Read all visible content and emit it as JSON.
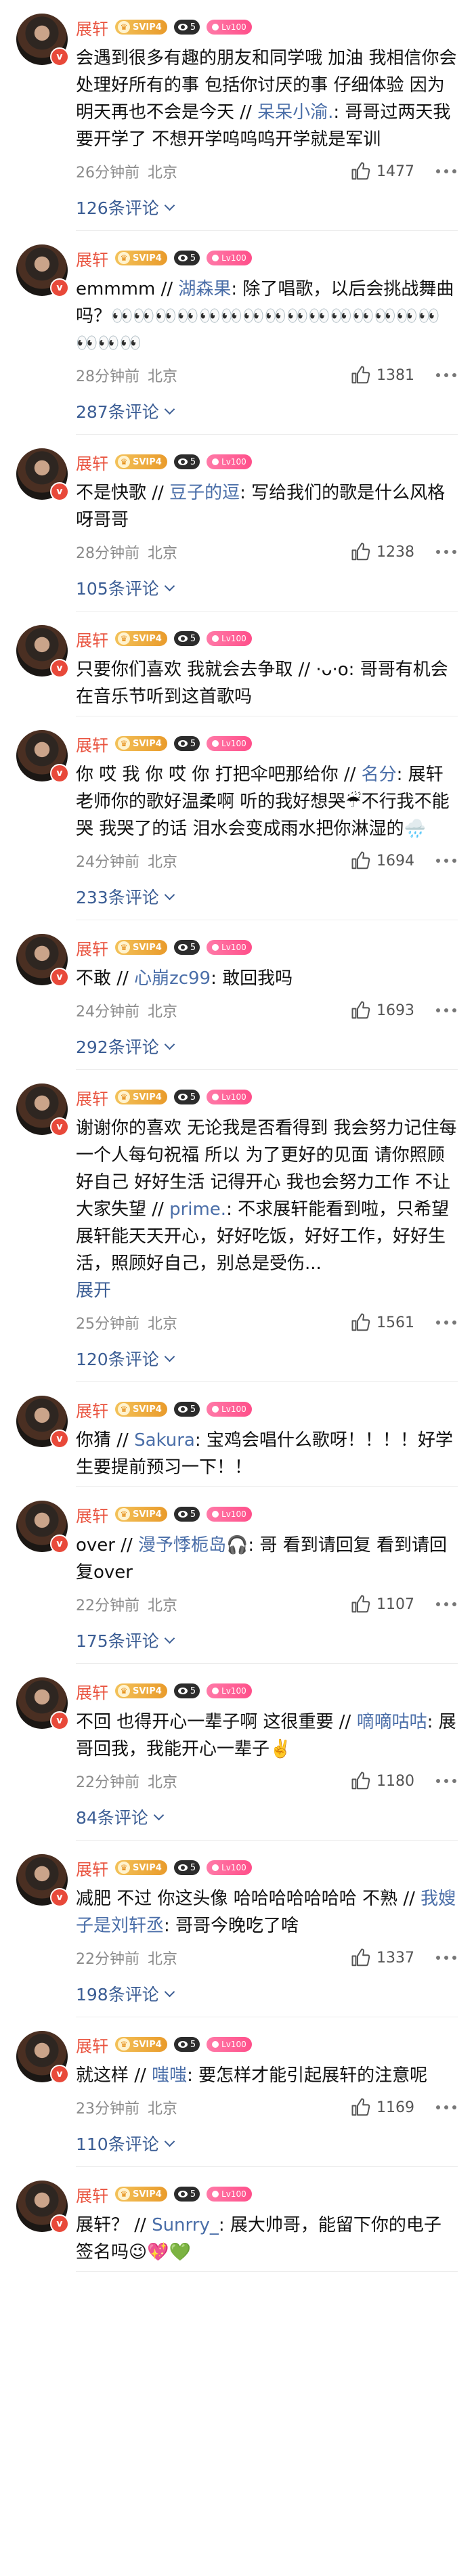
{
  "user": {
    "name": "展轩",
    "svip_label": "SVIP4",
    "weibo_badge": "5",
    "level_label": "Lv100",
    "verified_mark": "v"
  },
  "colors": {
    "name": "#e9533f",
    "mention": "#4a6ea8",
    "link": "#3b5d94"
  },
  "icons": {
    "like": "thumbs-up-icon",
    "more": "more-dots-icon",
    "expand": "chevron-down-icon"
  },
  "comments": [
    {
      "lead": "会遇到很多有趣的朋友和同学哦 加油 我相信你会处理好所有的事 包括你讨厌的事 仔细体验 因为明天再也不会是今天 // ",
      "mention": "呆呆小渝.",
      "tail": ": 哥哥过两天我要开学了 不想开学呜呜呜开学就是军训",
      "time": "26分钟前",
      "location": "北京",
      "likes": "1477",
      "replies": "126条评论",
      "expand": ""
    },
    {
      "lead": "emmmm // ",
      "mention": "湖森果",
      "tail": ": 除了唱歌，以后会挑战舞曲吗？👀👀👀👀👀👀👀👀👀👀👀👀👀👀👀👀👀👀",
      "time": "28分钟前",
      "location": "北京",
      "likes": "1381",
      "replies": "287条评论",
      "expand": ""
    },
    {
      "lead": "不是快歌 // ",
      "mention": "豆子的逗",
      "tail": ": 写给我们的歌是什么风格呀哥哥",
      "time": "28分钟前",
      "location": "北京",
      "likes": "1238",
      "replies": "105条评论",
      "expand": ""
    },
    {
      "lead": "只要你们喜欢 我就会去争取 // ",
      "mention": "",
      "tail": "·ᴗ·ο: 哥哥有机会在音乐节听到这首歌吗",
      "time": "",
      "location": "",
      "likes": "",
      "replies": "",
      "expand": ""
    },
    {
      "lead": "你 哎 我 你 哎 你 打把伞吧那给你 // ",
      "mention": "名分",
      "tail": ": 展轩老师你的歌好温柔啊 听的我好想哭☔不行我不能哭 我哭了的话 泪水会变成雨水把你淋湿的🌧️",
      "time": "24分钟前",
      "location": "北京",
      "likes": "1694",
      "replies": "233条评论",
      "expand": ""
    },
    {
      "lead": "不敢 // ",
      "mention": "心崩zc99",
      "tail": ": 敢回我吗",
      "time": "24分钟前",
      "location": "北京",
      "likes": "1693",
      "replies": "292条评论",
      "expand": ""
    },
    {
      "lead": "谢谢你的喜欢 无论我是否看得到 我会努力记住每一个人每句祝福 所以 为了更好的见面 请你照顾好自己 好好生活 记得开心 我也会努力工作 不让大家失望 // ",
      "mention": "prime.",
      "tail": ": 不求展轩能看到啦，只希望展轩能天天开心，好好吃饭，好好工作，好好生活，照顾好自己，别总是受伤...",
      "time": "25分钟前",
      "location": "北京",
      "likes": "1561",
      "replies": "120条评论",
      "expand": "展开"
    },
    {
      "lead": "你猜 // ",
      "mention": "Sakura",
      "tail": ": 宝鸡会唱什么歌呀！！！！好学生要提前预习一下！！",
      "time": "",
      "location": "",
      "likes": "",
      "replies": "",
      "expand": ""
    },
    {
      "lead": "over // ",
      "mention": "漫予悸栀岛🎧",
      "tail": ": 哥 看到请回复 看到请回复over",
      "time": "22分钟前",
      "location": "北京",
      "likes": "1107",
      "replies": "175条评论",
      "expand": ""
    },
    {
      "lead": "不回 也得开心一辈子啊 这很重要 // ",
      "mention": "嘀嘀咕咕",
      "tail": ": 展哥回我，我能开心一辈子✌️",
      "time": "22分钟前",
      "location": "北京",
      "likes": "1180",
      "replies": "84条评论",
      "expand": ""
    },
    {
      "lead": "减肥 不过 你这头像 哈哈哈哈哈哈哈 不熟 // ",
      "mention": "我嫂子是刘轩丞",
      "tail": ": 哥哥今晚吃了啥",
      "time": "22分钟前",
      "location": "北京",
      "likes": "1337",
      "replies": "198条评论",
      "expand": ""
    },
    {
      "lead": "就这样 // ",
      "mention": "嗤嗤",
      "tail": ": 要怎样才能引起展轩的注意呢",
      "time": "23分钟前",
      "location": "北京",
      "likes": "1169",
      "replies": "110条评论",
      "expand": ""
    },
    {
      "lead": "展轩？ // ",
      "mention": "Sunrry_",
      "tail": ": 展大帅哥，能留下你的电子签名吗😉💖💚",
      "time": "",
      "location": "",
      "likes": "",
      "replies": "",
      "expand": ""
    }
  ]
}
